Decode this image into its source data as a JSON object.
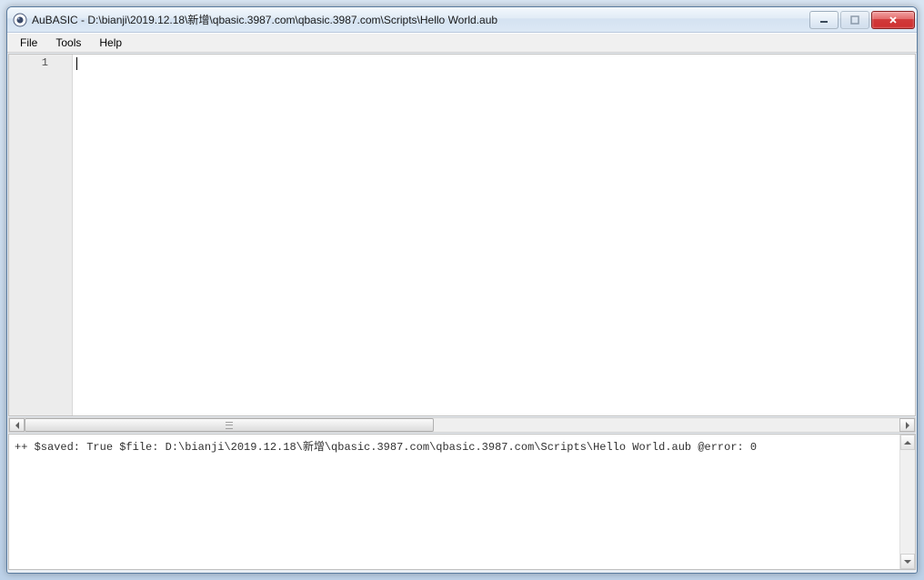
{
  "titlebar": {
    "title": "AuBASIC - D:\\bianji\\2019.12.18\\新增\\qbasic.3987.com\\qbasic.3987.com\\Scripts\\Hello World.aub"
  },
  "menu": {
    "file": "File",
    "tools": "Tools",
    "help": "Help"
  },
  "editor": {
    "line_number": "1",
    "content": ""
  },
  "console": {
    "output": "++ $saved: True $file: D:\\bianji\\2019.12.18\\新增\\qbasic.3987.com\\qbasic.3987.com\\Scripts\\Hello World.aub @error: 0"
  }
}
